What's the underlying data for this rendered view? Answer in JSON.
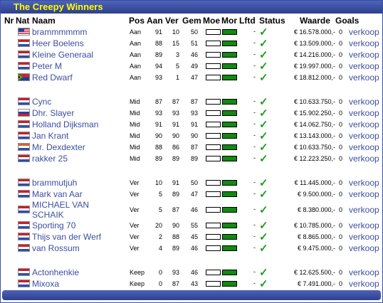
{
  "title": "The Creepy Winners",
  "headers": {
    "nr": "Nr",
    "nat": "Nat",
    "naam": "Naam",
    "pos": "Pos",
    "aan": "Aan",
    "ver": "Ver",
    "gem": "Gem",
    "moe": "Moe",
    "mor": "Mor",
    "lftd": "Lftd",
    "status": "Status",
    "waarde": "Waarde",
    "goals": "Goals"
  },
  "sell_label": "verkoop",
  "status_check": "✓",
  "lftd_dash": "-",
  "colors": {
    "frame": "#2f3f8c",
    "title": "#ffff00",
    "link": "#3c4ea0",
    "bar_fill": "#108a10",
    "check": "#1e9e1e"
  },
  "players": [
    {
      "flag": "us",
      "name": "brammmmmm",
      "pos": "Aan",
      "aan": "91",
      "ver": "10",
      "gem": "50",
      "waarde": "€ 16.578.000,-",
      "goals": "0"
    },
    {
      "flag": "nl",
      "name": "Heer Boelens",
      "pos": "Aan",
      "aan": "88",
      "ver": "15",
      "gem": "51",
      "waarde": "€ 13.509.000,-",
      "goals": "0"
    },
    {
      "flag": "nl",
      "name": "Kleine Generaal",
      "pos": "Aan",
      "aan": "89",
      "ver": "3",
      "gem": "46",
      "waarde": "€ 14.216.000,-",
      "goals": "0"
    },
    {
      "flag": "nl",
      "name": "Peter M",
      "pos": "Aan",
      "aan": "94",
      "ver": "5",
      "gem": "49",
      "waarde": "€ 19.997.000,-",
      "goals": "0"
    },
    {
      "flag": "za",
      "name": "Red Dwarf",
      "pos": "Aan",
      "aan": "93",
      "ver": "1",
      "gem": "47",
      "waarde": "€ 18.812.000,-",
      "goals": "0"
    },
    {
      "flag": "nl",
      "name": "Cync",
      "pos": "Mid",
      "aan": "87",
      "ver": "87",
      "gem": "87",
      "waarde": "€ 10.633.750,-",
      "goals": "0"
    },
    {
      "flag": "ru",
      "name": "Dhr. Slayer",
      "pos": "Mid",
      "aan": "93",
      "ver": "93",
      "gem": "93",
      "waarde": "€ 15.902.250,-",
      "goals": "0"
    },
    {
      "flag": "nl",
      "name": "Holland Dijksman",
      "pos": "Mid",
      "aan": "91",
      "ver": "91",
      "gem": "91",
      "waarde": "€ 14.062.750,-",
      "goals": "0"
    },
    {
      "flag": "nl",
      "name": "Jan Krant",
      "pos": "Mid",
      "aan": "90",
      "ver": "90",
      "gem": "90",
      "waarde": "€ 13.143.000,-",
      "goals": "0"
    },
    {
      "flag": "nl2",
      "name": "Mr. Dexdexter",
      "pos": "Mid",
      "aan": "88",
      "ver": "86",
      "gem": "87",
      "waarde": "€ 10.633.750,-",
      "goals": "0"
    },
    {
      "flag": "nl",
      "name": "rakker 25",
      "pos": "Mid",
      "aan": "89",
      "ver": "89",
      "gem": "89",
      "waarde": "€ 12.223.250,-",
      "goals": "0"
    },
    {
      "flag": "nl",
      "name": "brammutjuh",
      "pos": "Ver",
      "aan": "10",
      "ver": "91",
      "gem": "50",
      "waarde": "€ 11.445.000,-",
      "goals": "0"
    },
    {
      "flag": "nl",
      "name": "Mark van Aar",
      "pos": "Ver",
      "aan": "5",
      "ver": "89",
      "gem": "47",
      "waarde": "€ 9.500.000,-",
      "goals": "0"
    },
    {
      "flag": "nl",
      "name": "MICHAEL VAN SCHAIK",
      "pos": "Ver",
      "aan": "5",
      "ver": "87",
      "gem": "46",
      "waarde": "€ 8.380.000,-",
      "goals": "0"
    },
    {
      "flag": "nl",
      "name": "Sporting 70",
      "pos": "Ver",
      "aan": "20",
      "ver": "90",
      "gem": "55",
      "waarde": "€ 10.785.000,-",
      "goals": "0"
    },
    {
      "flag": "nl",
      "name": "Thijs van der Werf",
      "pos": "Ver",
      "aan": "2",
      "ver": "88",
      "gem": "45",
      "waarde": "€ 8.865.000,-",
      "goals": "0"
    },
    {
      "flag": "nl",
      "name": "van Rossum",
      "pos": "Ver",
      "aan": "4",
      "ver": "89",
      "gem": "46",
      "waarde": "€ 9.475.000,-",
      "goals": "0"
    },
    {
      "flag": "nl",
      "name": "Actonhenkie",
      "pos": "Keep",
      "aan": "0",
      "ver": "93",
      "gem": "46",
      "waarde": "€ 12.625.500,-",
      "goals": "0"
    },
    {
      "flag": "nl",
      "name": "Mixoxa",
      "pos": "Keep",
      "aan": "0",
      "ver": "87",
      "gem": "43",
      "waarde": "€ 7.491.000,-",
      "goals": "0"
    }
  ]
}
